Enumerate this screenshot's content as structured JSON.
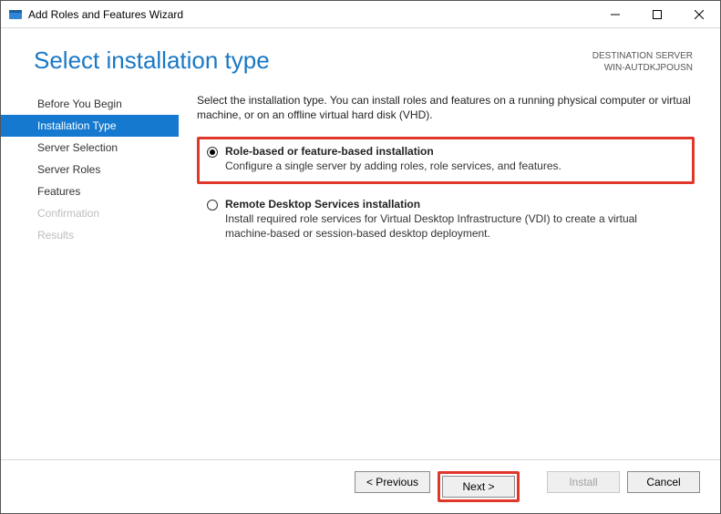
{
  "titlebar": {
    "title": "Add Roles and Features Wizard"
  },
  "header": {
    "page_title": "Select installation type",
    "server_label": "DESTINATION SERVER",
    "server_name": "WIN-AUTDKJPOUSN"
  },
  "sidebar": {
    "items": [
      {
        "label": "Before You Begin",
        "active": false,
        "disabled": false
      },
      {
        "label": "Installation Type",
        "active": true,
        "disabled": false
      },
      {
        "label": "Server Selection",
        "active": false,
        "disabled": false
      },
      {
        "label": "Server Roles",
        "active": false,
        "disabled": false
      },
      {
        "label": "Features",
        "active": false,
        "disabled": false
      },
      {
        "label": "Confirmation",
        "active": false,
        "disabled": true
      },
      {
        "label": "Results",
        "active": false,
        "disabled": true
      }
    ]
  },
  "content": {
    "intro": "Select the installation type. You can install roles and features on a running physical computer or virtual machine, or on an offline virtual hard disk (VHD).",
    "options": [
      {
        "title": "Role-based or feature-based installation",
        "desc": "Configure a single server by adding roles, role services, and features.",
        "checked": true,
        "highlight": true
      },
      {
        "title": "Remote Desktop Services installation",
        "desc": "Install required role services for Virtual Desktop Infrastructure (VDI) to create a virtual machine-based or session-based desktop deployment.",
        "checked": false,
        "highlight": false
      }
    ]
  },
  "footer": {
    "previous": "< Previous",
    "next": "Next >",
    "install": "Install",
    "cancel": "Cancel"
  }
}
